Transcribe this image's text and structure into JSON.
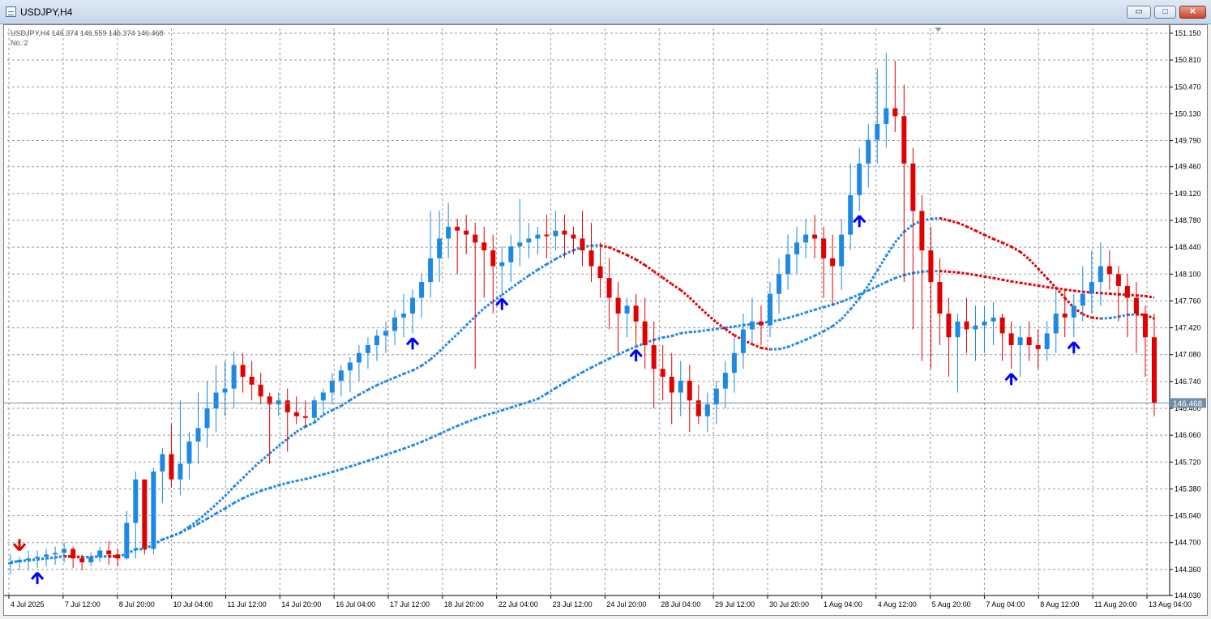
{
  "window": {
    "title": "USDJPY,H4",
    "buttons": {
      "minimize": "▭",
      "maximize": "□",
      "close": "✕"
    }
  },
  "info": {
    "line1": "USDJPY,H4  146.374 146.559 146.374 146.468",
    "line2": "No.:2"
  },
  "price_tag": "146.468",
  "colors": {
    "bull": "#1e88e5",
    "bear": "#e00000",
    "arrow_up": "#0000ff",
    "arrow_down": "#e00000",
    "grid": "#9a9a9a",
    "price_line": "#6f8ea8"
  },
  "chart_data": {
    "type": "bar",
    "symbol": "USDJPY",
    "timeframe": "H4",
    "ylim": [
      144.03,
      151.15
    ],
    "y_ticks": [
      "151.150",
      "150.810",
      "150.470",
      "150.130",
      "149.790",
      "149.460",
      "149.120",
      "148.780",
      "148.440",
      "148.100",
      "147.760",
      "147.420",
      "147.080",
      "146.740",
      "146.400",
      "146.060",
      "145.720",
      "145.380",
      "145.040",
      "144.700",
      "144.360",
      "144.030"
    ],
    "x_labels": [
      "4 Jul 2025",
      "7 Jul 12:00",
      "8 Jul 20:00",
      "10 Jul 04:00",
      "11 Jul 12:00",
      "14 Jul 20:00",
      "16 Jul 04:00",
      "17 Jul 12:00",
      "18 Jul 20:00",
      "22 Jul 04:00",
      "23 Jul 12:00",
      "24 Jul 20:00",
      "28 Jul 04:00",
      "29 Jul 12:00",
      "30 Jul 20:00",
      "1 Aug 04:00",
      "4 Aug 12:00",
      "5 Aug 20:00",
      "7 Aug 04:00",
      "8 Aug 12:00",
      "11 Aug 20:00",
      "13 Aug 04:00"
    ],
    "last_price": 146.468,
    "bars": [
      [
        144.45,
        144.55,
        144.3,
        144.45
      ],
      [
        144.45,
        144.52,
        144.35,
        144.48
      ],
      [
        144.48,
        144.6,
        144.35,
        144.5
      ],
      [
        144.5,
        144.6,
        144.38,
        144.52
      ],
      [
        144.52,
        144.62,
        144.4,
        144.55
      ],
      [
        144.55,
        144.65,
        144.42,
        144.57
      ],
      [
        144.57,
        144.7,
        144.45,
        144.62
      ],
      [
        144.62,
        144.65,
        144.38,
        144.5
      ],
      [
        144.5,
        144.55,
        144.35,
        144.45
      ],
      [
        144.45,
        144.58,
        144.4,
        144.52
      ],
      [
        144.52,
        144.65,
        144.45,
        144.6
      ],
      [
        144.6,
        144.72,
        144.42,
        144.55
      ],
      [
        144.55,
        144.62,
        144.4,
        144.5
      ],
      [
        144.5,
        145.1,
        144.48,
        144.95
      ],
      [
        144.95,
        145.6,
        144.5,
        145.5
      ],
      [
        145.5,
        145.45,
        144.55,
        144.62
      ],
      [
        144.62,
        145.65,
        144.55,
        145.6
      ],
      [
        145.6,
        145.9,
        145.2,
        145.82
      ],
      [
        145.82,
        146.2,
        145.4,
        145.5
      ],
      [
        145.5,
        146.5,
        145.3,
        145.7
      ],
      [
        145.7,
        146.1,
        145.5,
        145.98
      ],
      [
        145.98,
        146.6,
        145.7,
        146.15
      ],
      [
        146.15,
        146.75,
        145.9,
        146.4
      ],
      [
        146.4,
        146.95,
        146.1,
        146.6
      ],
      [
        146.6,
        147.0,
        146.3,
        146.65
      ],
      [
        146.65,
        147.12,
        146.4,
        146.95
      ],
      [
        146.95,
        147.1,
        146.6,
        146.8
      ],
      [
        146.8,
        147.0,
        146.5,
        146.7
      ],
      [
        146.7,
        146.85,
        146.45,
        146.55
      ],
      [
        146.55,
        146.6,
        145.7,
        146.45
      ],
      [
        146.45,
        146.6,
        146.3,
        146.5
      ],
      [
        146.5,
        146.65,
        145.85,
        146.35
      ],
      [
        146.35,
        146.55,
        146.2,
        146.3
      ],
      [
        146.3,
        146.5,
        146.15,
        146.28
      ],
      [
        146.28,
        146.55,
        146.2,
        146.5
      ],
      [
        146.5,
        146.65,
        146.3,
        146.6
      ],
      [
        146.6,
        146.85,
        146.45,
        146.75
      ],
      [
        146.75,
        146.95,
        146.55,
        146.88
      ],
      [
        146.88,
        147.05,
        146.6,
        146.98
      ],
      [
        146.98,
        147.2,
        146.75,
        147.1
      ],
      [
        147.1,
        147.3,
        146.9,
        147.2
      ],
      [
        147.2,
        147.4,
        147.0,
        147.32
      ],
      [
        147.32,
        147.5,
        147.1,
        147.38
      ],
      [
        147.38,
        147.65,
        147.2,
        147.55
      ],
      [
        147.55,
        147.85,
        147.3,
        147.6
      ],
      [
        147.6,
        147.9,
        147.35,
        147.8
      ],
      [
        147.8,
        148.1,
        147.55,
        148.0
      ],
      [
        148.0,
        148.9,
        147.8,
        148.3
      ],
      [
        148.3,
        148.9,
        148.0,
        148.55
      ],
      [
        148.55,
        149.0,
        148.3,
        148.7
      ],
      [
        148.7,
        148.8,
        148.1,
        148.65
      ],
      [
        148.65,
        148.85,
        148.35,
        148.6
      ],
      [
        148.6,
        148.75,
        146.9,
        148.5
      ],
      [
        148.5,
        148.7,
        147.8,
        148.4
      ],
      [
        148.4,
        148.6,
        147.6,
        148.2
      ],
      [
        148.2,
        148.45,
        147.85,
        148.25
      ],
      [
        148.25,
        148.6,
        148.0,
        148.45
      ],
      [
        148.45,
        149.05,
        148.2,
        148.5
      ],
      [
        148.5,
        148.75,
        148.3,
        148.55
      ],
      [
        148.55,
        148.7,
        148.35,
        148.6
      ],
      [
        148.6,
        148.85,
        148.3,
        148.58
      ],
      [
        148.58,
        148.9,
        148.4,
        148.65
      ],
      [
        148.65,
        148.85,
        148.3,
        148.6
      ],
      [
        148.6,
        148.7,
        148.35,
        148.55
      ],
      [
        148.55,
        148.9,
        148.2,
        148.4
      ],
      [
        148.4,
        148.75,
        148.0,
        148.2
      ],
      [
        148.2,
        148.5,
        147.8,
        148.05
      ],
      [
        148.05,
        148.3,
        147.4,
        147.8
      ],
      [
        147.8,
        148.0,
        147.1,
        147.6
      ],
      [
        147.6,
        147.8,
        147.3,
        147.7
      ],
      [
        147.7,
        147.85,
        147.2,
        147.5
      ],
      [
        147.5,
        147.8,
        146.9,
        147.2
      ],
      [
        147.2,
        147.5,
        146.4,
        146.9
      ],
      [
        146.9,
        147.2,
        146.5,
        146.8
      ],
      [
        146.8,
        147.1,
        146.2,
        146.6
      ],
      [
        146.6,
        147.0,
        146.3,
        146.75
      ],
      [
        146.75,
        146.95,
        146.1,
        146.5
      ],
      [
        146.5,
        146.7,
        146.2,
        146.3
      ],
      [
        146.3,
        146.6,
        146.1,
        146.45
      ],
      [
        146.45,
        146.75,
        146.2,
        146.65
      ],
      [
        146.65,
        147.0,
        146.4,
        146.85
      ],
      [
        146.85,
        147.3,
        146.6,
        147.1
      ],
      [
        147.1,
        147.6,
        146.9,
        147.4
      ],
      [
        147.4,
        147.8,
        147.2,
        147.5
      ],
      [
        147.5,
        147.7,
        147.2,
        147.45
      ],
      [
        147.45,
        148.0,
        147.3,
        147.85
      ],
      [
        147.85,
        148.3,
        147.6,
        148.1
      ],
      [
        148.1,
        148.6,
        147.9,
        148.35
      ],
      [
        148.35,
        148.7,
        148.1,
        148.5
      ],
      [
        148.5,
        148.8,
        148.3,
        148.6
      ],
      [
        148.6,
        148.85,
        148.3,
        148.55
      ],
      [
        148.55,
        148.7,
        147.8,
        148.3
      ],
      [
        148.3,
        148.6,
        147.7,
        148.2
      ],
      [
        148.2,
        148.8,
        147.9,
        148.6
      ],
      [
        148.6,
        149.5,
        148.4,
        149.1
      ],
      [
        149.1,
        149.7,
        148.9,
        149.5
      ],
      [
        149.5,
        150.0,
        149.2,
        149.8
      ],
      [
        149.8,
        150.7,
        149.5,
        150.0
      ],
      [
        150.0,
        150.9,
        149.7,
        150.2
      ],
      [
        150.2,
        150.8,
        149.9,
        150.1
      ],
      [
        150.1,
        150.5,
        148.0,
        149.5
      ],
      [
        149.5,
        149.7,
        147.4,
        148.9
      ],
      [
        148.9,
        149.1,
        147.0,
        148.4
      ],
      [
        148.4,
        148.7,
        146.9,
        148.0
      ],
      [
        148.0,
        148.3,
        147.2,
        147.6
      ],
      [
        147.6,
        147.8,
        146.8,
        147.3
      ],
      [
        147.3,
        147.6,
        146.6,
        147.5
      ],
      [
        147.5,
        147.8,
        147.1,
        147.4
      ],
      [
        147.4,
        147.7,
        147.0,
        147.45
      ],
      [
        147.45,
        147.7,
        147.1,
        147.5
      ],
      [
        147.5,
        147.75,
        147.2,
        147.55
      ],
      [
        147.55,
        147.6,
        147.0,
        147.35
      ],
      [
        147.35,
        147.5,
        146.9,
        147.2
      ],
      [
        147.2,
        147.45,
        146.8,
        147.3
      ],
      [
        147.3,
        147.5,
        147.0,
        147.2
      ],
      [
        147.2,
        147.4,
        146.9,
        147.15
      ],
      [
        147.15,
        147.5,
        147.0,
        147.35
      ],
      [
        147.35,
        147.9,
        147.1,
        147.6
      ],
      [
        147.6,
        147.9,
        147.3,
        147.55
      ],
      [
        147.55,
        147.85,
        147.3,
        147.7
      ],
      [
        147.7,
        148.2,
        147.5,
        147.85
      ],
      [
        147.85,
        148.4,
        147.6,
        148.0
      ],
      [
        148.0,
        148.5,
        147.7,
        148.2
      ],
      [
        148.2,
        148.4,
        147.9,
        148.1
      ],
      [
        148.1,
        148.2,
        147.5,
        147.95
      ],
      [
        147.95,
        148.1,
        147.3,
        147.8
      ],
      [
        147.8,
        148.0,
        147.1,
        147.6
      ],
      [
        147.6,
        147.7,
        146.8,
        147.3
      ],
      [
        147.3,
        147.6,
        146.3,
        146.47
      ]
    ],
    "arrows_up": [
      3,
      45,
      55,
      70,
      95,
      112,
      119
    ],
    "arrows_down": [
      1
    ]
  }
}
